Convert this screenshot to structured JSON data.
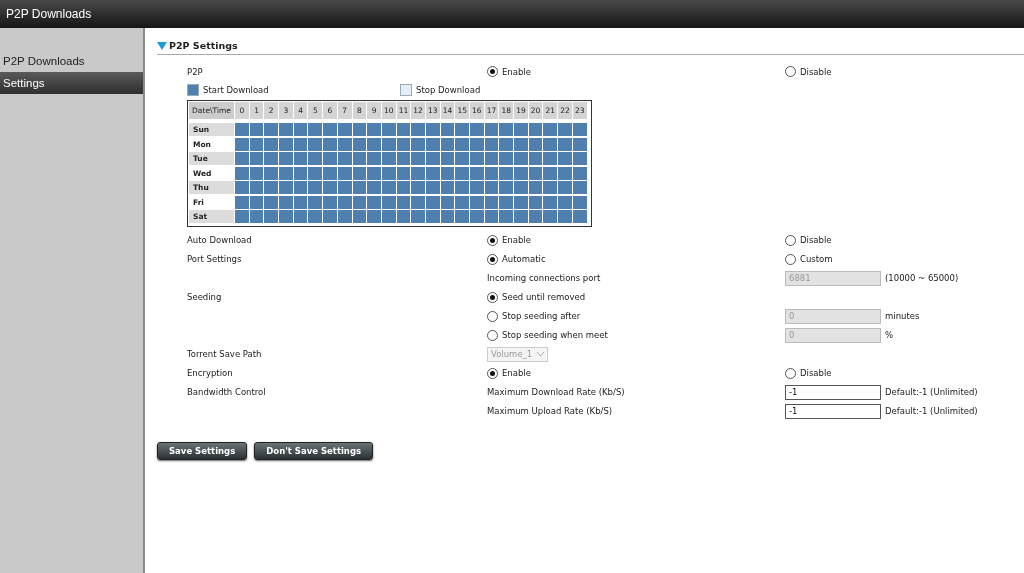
{
  "window": {
    "title": "P2P Downloads"
  },
  "sidebar": {
    "items": [
      {
        "label": "P2P Downloads",
        "selected": false
      },
      {
        "label": "Settings",
        "selected": true
      }
    ]
  },
  "section": {
    "title": "P2P Settings",
    "expanded": true
  },
  "p2p": {
    "label": "P2P",
    "options": [
      {
        "label": "Enable",
        "selected": true
      },
      {
        "label": "Disable",
        "selected": false
      }
    ]
  },
  "legend": [
    {
      "label": "Start Download",
      "kind": "start"
    },
    {
      "label": "Stop Download",
      "kind": "stop"
    }
  ],
  "schedule": {
    "corner": "Date\\Time",
    "hours": [
      "0",
      "1",
      "2",
      "3",
      "4",
      "5",
      "6",
      "7",
      "8",
      "9",
      "10",
      "11",
      "12",
      "13",
      "14",
      "15",
      "16",
      "17",
      "18",
      "19",
      "20",
      "21",
      "22",
      "23"
    ],
    "days": [
      {
        "label": "Sun",
        "shaded": true,
        "active": [
          true,
          true,
          true,
          true,
          true,
          true,
          true,
          true,
          true,
          true,
          true,
          true,
          true,
          true,
          true,
          true,
          true,
          true,
          true,
          true,
          true,
          true,
          true,
          true
        ]
      },
      {
        "label": "Mon",
        "shaded": false,
        "active": [
          true,
          true,
          true,
          true,
          true,
          true,
          true,
          true,
          true,
          true,
          true,
          true,
          true,
          true,
          true,
          true,
          true,
          true,
          true,
          true,
          true,
          true,
          true,
          true
        ]
      },
      {
        "label": "Tue",
        "shaded": true,
        "active": [
          true,
          true,
          true,
          true,
          true,
          true,
          true,
          true,
          true,
          true,
          true,
          true,
          true,
          true,
          true,
          true,
          true,
          true,
          true,
          true,
          true,
          true,
          true,
          true
        ]
      },
      {
        "label": "Wed",
        "shaded": false,
        "active": [
          true,
          true,
          true,
          true,
          true,
          true,
          true,
          true,
          true,
          true,
          true,
          true,
          true,
          true,
          true,
          true,
          true,
          true,
          true,
          true,
          true,
          true,
          true,
          true
        ]
      },
      {
        "label": "Thu",
        "shaded": true,
        "active": [
          true,
          true,
          true,
          true,
          true,
          true,
          true,
          true,
          true,
          true,
          true,
          true,
          true,
          true,
          true,
          true,
          true,
          true,
          true,
          true,
          true,
          true,
          true,
          true
        ]
      },
      {
        "label": "Fri",
        "shaded": false,
        "active": [
          true,
          true,
          true,
          true,
          true,
          true,
          true,
          true,
          true,
          true,
          true,
          true,
          true,
          true,
          true,
          true,
          true,
          true,
          true,
          true,
          true,
          true,
          true,
          true
        ]
      },
      {
        "label": "Sat",
        "shaded": true,
        "active": [
          true,
          true,
          true,
          true,
          true,
          true,
          true,
          true,
          true,
          true,
          true,
          true,
          true,
          true,
          true,
          true,
          true,
          true,
          true,
          true,
          true,
          true,
          true,
          true
        ]
      }
    ]
  },
  "rows": [
    {
      "label": "Auto Download",
      "middle": {
        "kind": "radio",
        "label": "Enable",
        "selected": true
      },
      "right": {
        "kind": "radio",
        "label": "Disable",
        "selected": false
      }
    },
    {
      "label": "Port Settings",
      "middle": {
        "kind": "radio",
        "label": "Automatic",
        "selected": true
      },
      "right": {
        "kind": "radio",
        "label": "Custom",
        "selected": false
      }
    },
    {
      "middle": {
        "kind": "text",
        "label": "Incoming connections port"
      },
      "right": {
        "kind": "field",
        "value": "6881",
        "disabled": true,
        "suffix": "(10000 ~ 65000)"
      }
    },
    {
      "label": "Seeding",
      "middle": {
        "kind": "radio",
        "label": "Seed until removed",
        "selected": true
      }
    },
    {
      "middle": {
        "kind": "radio",
        "label": "Stop seeding after",
        "selected": false
      },
      "right": {
        "kind": "field",
        "value": "0",
        "disabled": true,
        "suffix": "minutes"
      }
    },
    {
      "middle": {
        "kind": "radio",
        "label": "Stop seeding when meet",
        "selected": false
      },
      "right": {
        "kind": "field",
        "value": "0",
        "disabled": true,
        "suffix": "%"
      }
    },
    {
      "label": "Torrent Save Path",
      "middle": {
        "kind": "select",
        "value": "Volume_1",
        "disabled": true
      }
    },
    {
      "label": "Encryption",
      "middle": {
        "kind": "radio",
        "label": "Enable",
        "selected": true
      },
      "right": {
        "kind": "radio",
        "label": "Disable",
        "selected": false
      }
    },
    {
      "label": "Bandwidth Control",
      "middle": {
        "kind": "text",
        "label": "Maximum Download Rate (Kb/S)"
      },
      "right": {
        "kind": "field",
        "value": "-1",
        "disabled": false,
        "suffix": "Default:-1 (Unlimited)"
      }
    },
    {
      "middle": {
        "kind": "text",
        "label": "Maximum Upload Rate (Kb/S)"
      },
      "right": {
        "kind": "field",
        "value": "-1",
        "disabled": false,
        "suffix": "Default:-1 (Unlimited)"
      }
    }
  ],
  "buttons": [
    "Save Settings",
    "Don't Save Settings"
  ]
}
